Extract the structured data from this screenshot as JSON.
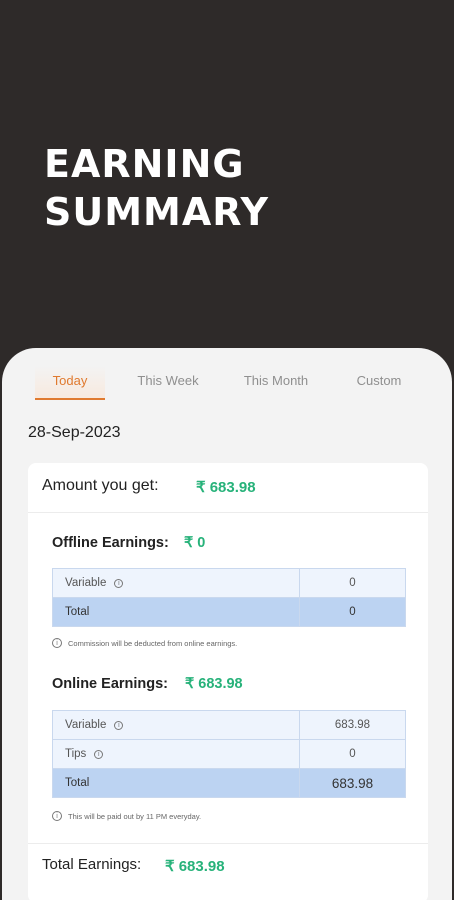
{
  "hero": {
    "title": "EARNING\nSUMMARY"
  },
  "tabs": [
    {
      "label": "Today"
    },
    {
      "label": "This Week"
    },
    {
      "label": "This Month"
    },
    {
      "label": "Custom"
    }
  ],
  "date": "28-Sep-2023",
  "amount": {
    "label": "Amount you get:",
    "value": "₹ 683.98"
  },
  "offline": {
    "title": "Offline Earnings:",
    "value": "₹ 0",
    "rows": [
      {
        "label": "Variable",
        "value": "0"
      }
    ],
    "total_label": "Total",
    "total_value": "0",
    "note": "Commission will be deducted from online earnings."
  },
  "online": {
    "title": "Online Earnings:",
    "value": "₹ 683.98",
    "rows": [
      {
        "label": "Variable",
        "value": "683.98"
      },
      {
        "label": "Tips",
        "value": "0"
      }
    ],
    "total_label": "Total",
    "total_value": "683.98",
    "note": "This will be paid out by 11 PM everyday."
  },
  "total_earnings": {
    "label": "Total Earnings:",
    "value": "₹ 683.98"
  },
  "info_glyph": "i",
  "colors": {
    "accent": "#e07a2f",
    "green": "#27b27a",
    "red": "#e53935",
    "dark": "#2e2a29",
    "table_total": "#bcd3f2"
  }
}
